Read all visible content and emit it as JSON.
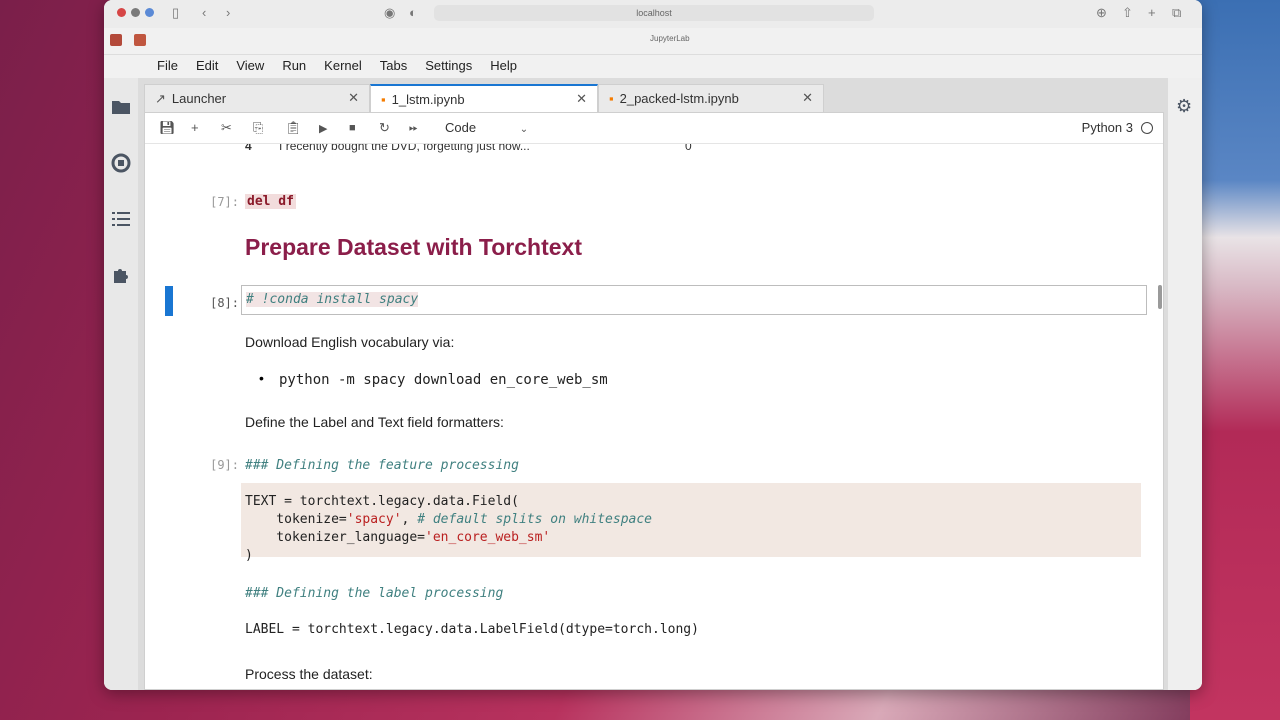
{
  "browser": {
    "url": "localhost",
    "tab_title": "JupyterLab"
  },
  "menu": [
    "File",
    "Edit",
    "View",
    "Run",
    "Kernel",
    "Tabs",
    "Settings",
    "Help"
  ],
  "tabs": [
    {
      "label": "Launcher",
      "active": false
    },
    {
      "label": "1_lstm.ipynb",
      "active": true
    },
    {
      "label": "2_packed-lstm.ipynb",
      "active": false
    }
  ],
  "toolbar": {
    "cell_type": "Code",
    "kernel": "Python 3"
  },
  "notebook": {
    "top_row": {
      "index": "4",
      "text": "I recently bought the DVD, forgetting just how...",
      "label": "0"
    },
    "cell7": {
      "prompt": "[7]:",
      "code": "del df"
    },
    "heading": "Prepare Dataset with Torchtext",
    "cell8": {
      "prompt": "[8]:",
      "comment": "# !conda install spacy"
    },
    "md1": "Download English vocabulary via:",
    "md1_bullet": "python -m spacy download en_core_web_sm",
    "md2": "Define the Label and Text field formatters:",
    "cell9": {
      "prompt": "[9]:",
      "line1": "### Defining the feature processing",
      "line2a": "TEXT = torchtext.legacy.data.Field(",
      "line3a": "    tokenize=",
      "line3b": "'spacy'",
      "line3c": ", ",
      "line3d": "# default splits on whitespace",
      "line4a": "    tokenizer_language=",
      "line4b": "'en_core_web_sm'",
      "line5": ")",
      "line6": "### Defining the label processing",
      "line7": "LABEL = torchtext.legacy.data.LabelField(dtype=torch.long)"
    },
    "md3": "Process the dataset:"
  }
}
